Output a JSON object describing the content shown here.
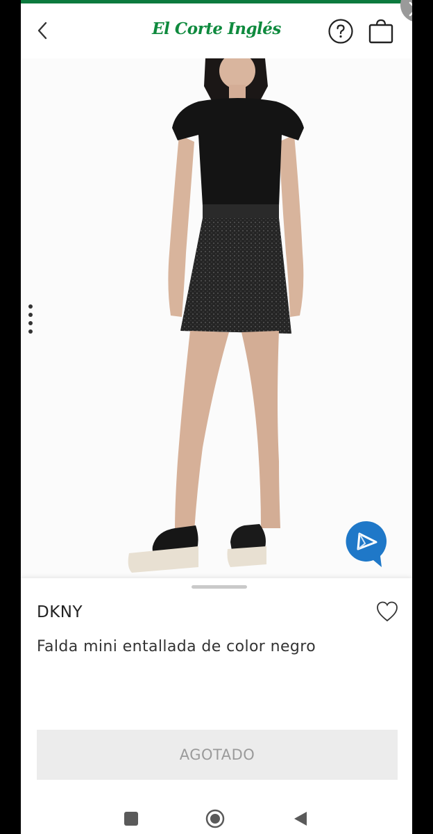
{
  "header": {
    "logo_text": "El Corte Inglés",
    "back_icon": "chevron-left-icon",
    "help_icon": "question-circle-icon",
    "bag_icon": "shopping-bag-icon"
  },
  "overlay": {
    "close_icon": "close-icon"
  },
  "product": {
    "brand": "DKNY",
    "name": "Falda mini entallada de color negro",
    "cta_label": "AGOTADO",
    "favorite_icon": "heart-outline-icon"
  },
  "colors": {
    "brand_green": "#0f8a3e",
    "accent_bar": "#0c7a3e",
    "cta_bg": "#ececec",
    "cta_text": "#9a9a9a"
  },
  "system_nav": {
    "recents_icon": "square-icon",
    "home_icon": "circle-icon",
    "back_icon": "triangle-back-icon"
  }
}
